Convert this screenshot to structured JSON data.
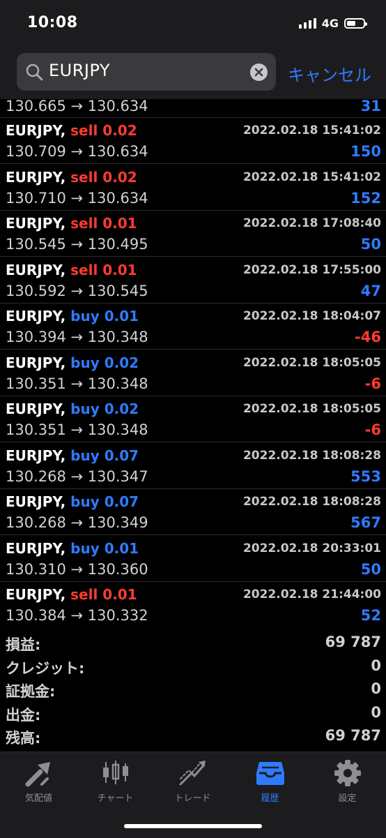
{
  "status": {
    "time": "10:08",
    "network": "4G"
  },
  "search": {
    "query": "EURJPY",
    "cancel_label": "キャンセル"
  },
  "partial_row": {
    "prices": "130.665 → 130.634",
    "profit": "31"
  },
  "trades": [
    {
      "symbol": "EURJPY,",
      "type": "sell 0.02",
      "side": "sell",
      "datetime": "2022.02.18 15:41:02",
      "prices": "130.709 → 130.634",
      "profit": "150"
    },
    {
      "symbol": "EURJPY,",
      "type": "sell 0.02",
      "side": "sell",
      "datetime": "2022.02.18 15:41:02",
      "prices": "130.710 → 130.634",
      "profit": "152"
    },
    {
      "symbol": "EURJPY,",
      "type": "sell 0.01",
      "side": "sell",
      "datetime": "2022.02.18 17:08:40",
      "prices": "130.545 → 130.495",
      "profit": "50"
    },
    {
      "symbol": "EURJPY,",
      "type": "sell 0.01",
      "side": "sell",
      "datetime": "2022.02.18 17:55:00",
      "prices": "130.592 → 130.545",
      "profit": "47"
    },
    {
      "symbol": "EURJPY,",
      "type": "buy 0.01",
      "side": "buy",
      "datetime": "2022.02.18 18:04:07",
      "prices": "130.394 → 130.348",
      "profit": "-46"
    },
    {
      "symbol": "EURJPY,",
      "type": "buy 0.02",
      "side": "buy",
      "datetime": "2022.02.18 18:05:05",
      "prices": "130.351 → 130.348",
      "profit": "-6"
    },
    {
      "symbol": "EURJPY,",
      "type": "buy 0.02",
      "side": "buy",
      "datetime": "2022.02.18 18:05:05",
      "prices": "130.351 → 130.348",
      "profit": "-6"
    },
    {
      "symbol": "EURJPY,",
      "type": "buy 0.07",
      "side": "buy",
      "datetime": "2022.02.18 18:08:28",
      "prices": "130.268 → 130.347",
      "profit": "553"
    },
    {
      "symbol": "EURJPY,",
      "type": "buy 0.07",
      "side": "buy",
      "datetime": "2022.02.18 18:08:28",
      "prices": "130.268 → 130.349",
      "profit": "567"
    },
    {
      "symbol": "EURJPY,",
      "type": "buy 0.01",
      "side": "buy",
      "datetime": "2022.02.18 20:33:01",
      "prices": "130.310 → 130.360",
      "profit": "50"
    },
    {
      "symbol": "EURJPY,",
      "type": "sell 0.01",
      "side": "sell",
      "datetime": "2022.02.18 21:44:00",
      "prices": "130.384 → 130.332",
      "profit": "52"
    }
  ],
  "summary": [
    {
      "label": "損益:",
      "value": "69 787"
    },
    {
      "label": "クレジット:",
      "value": "0"
    },
    {
      "label": "証拠金:",
      "value": "0"
    },
    {
      "label": "出金:",
      "value": "0"
    },
    {
      "label": "残高:",
      "value": "69 787"
    }
  ],
  "tabs": [
    {
      "label": "気配値",
      "icon": "quotes-icon"
    },
    {
      "label": "チャート",
      "icon": "chart-icon"
    },
    {
      "label": "トレード",
      "icon": "trade-icon"
    },
    {
      "label": "履歴",
      "icon": "history-icon",
      "active": true
    },
    {
      "label": "設定",
      "icon": "settings-icon"
    }
  ],
  "colors": {
    "sell": "#ff3b30",
    "buy": "#2f7bff",
    "accent": "#2f7bff",
    "background": "#000000"
  }
}
